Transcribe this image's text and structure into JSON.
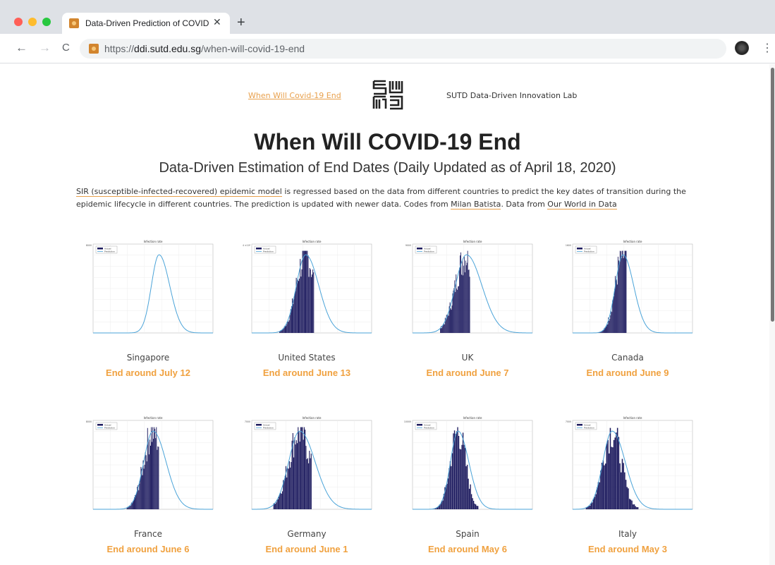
{
  "browser": {
    "tab_title": "Data-Driven Prediction of COVID",
    "tab_close": "✕",
    "new_tab": "+",
    "url_prefix": "https://",
    "url_domain": "ddi.sutd.edu.sg",
    "url_path": "/when-will-covid-19-end",
    "back": "←",
    "forward": "→",
    "reload": "C",
    "menu": "⋮",
    "traffic_colors": [
      "#ff5f57",
      "#febc2e",
      "#28c840"
    ]
  },
  "header": {
    "nav_link": "When Will Covid-19 End",
    "lab_name": "SUTD Data-Driven Innovation Lab"
  },
  "main": {
    "title": "When Will COVID-19 End",
    "subtitle": "Data-Driven Estimation of End Dates (Daily Updated as of April 18, 2020)",
    "desc_link_model": "SIR (susceptible-infected-recovered) epidemic model",
    "desc_text_1": " is regressed based on the data from different countries to predict the key dates of transition during the epidemic lifecycle in different countries. The prediction is updated with newer data. Codes from ",
    "desc_link_codes": "Milan Batista",
    "desc_text_2": ". Data from ",
    "desc_link_data": "Our World in Data"
  },
  "colors": {
    "accent": "#f0a13f",
    "bar": "#1c1a5e",
    "curve": "#4aa3d8"
  },
  "countries": [
    {
      "name": "Singapore",
      "end": "End around July 12"
    },
    {
      "name": "United States",
      "end": "End around June 13"
    },
    {
      "name": "UK",
      "end": "End around June 7"
    },
    {
      "name": "Canada",
      "end": "End around June 9"
    },
    {
      "name": "France",
      "end": "End around June 6"
    },
    {
      "name": "Germany",
      "end": "End around June 1"
    },
    {
      "name": "Spain",
      "end": "End around May 6"
    },
    {
      "name": "Italy",
      "end": "End around May 3"
    }
  ],
  "chart_data": [
    {
      "type": "bar",
      "title": "Infection rate",
      "series": [
        {
          "name": "Actual"
        },
        {
          "name": "Prediction"
        }
      ],
      "peak_fraction": 0.55,
      "bar_end_fraction": 0.23,
      "ymax_label": "8000"
    },
    {
      "type": "bar",
      "title": "Infection rate",
      "series": [
        {
          "name": "Actual"
        },
        {
          "name": "Prediction"
        }
      ],
      "peak_fraction": 0.45,
      "bar_end_fraction": 0.52,
      "ymax_label": "4 ×10⁴"
    },
    {
      "type": "bar",
      "title": "Infection rate",
      "series": [
        {
          "name": "Actual"
        },
        {
          "name": "Prediction"
        }
      ],
      "peak_fraction": 0.45,
      "bar_end_fraction": 0.48,
      "ymax_label": "9000"
    },
    {
      "type": "bar",
      "title": "Infection rate",
      "series": [
        {
          "name": "Actual"
        },
        {
          "name": "Prediction"
        }
      ],
      "peak_fraction": 0.42,
      "bar_end_fraction": 0.45,
      "ymax_label": "1600"
    },
    {
      "type": "bar",
      "title": "Infection rate",
      "series": [
        {
          "name": "Actual"
        },
        {
          "name": "Prediction"
        }
      ],
      "peak_fraction": 0.5,
      "bar_end_fraction": 0.55,
      "ymax_label": "8000"
    },
    {
      "type": "bar",
      "title": "Infection rate",
      "series": [
        {
          "name": "Actual"
        },
        {
          "name": "Prediction"
        }
      ],
      "peak_fraction": 0.4,
      "bar_end_fraction": 0.5,
      "ymax_label": "7000"
    },
    {
      "type": "bar",
      "title": "Infection rate",
      "series": [
        {
          "name": "Actual"
        },
        {
          "name": "Prediction"
        }
      ],
      "peak_fraction": 0.38,
      "bar_end_fraction": 0.55,
      "ymax_label": "10000"
    },
    {
      "type": "bar",
      "title": "Infection rate",
      "series": [
        {
          "name": "Actual"
        },
        {
          "name": "Prediction"
        }
      ],
      "peak_fraction": 0.33,
      "bar_end_fraction": 0.55,
      "ymax_label": "7000"
    }
  ]
}
